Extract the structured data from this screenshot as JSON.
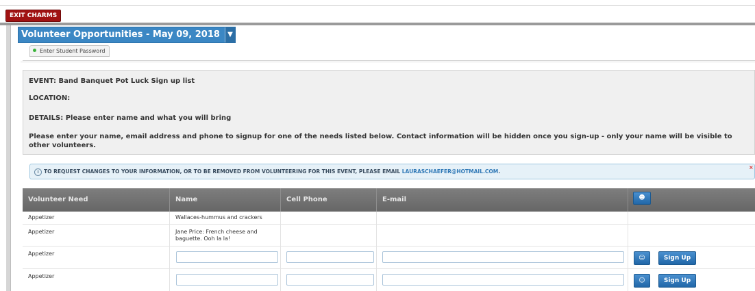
{
  "header": {
    "exit_label": "EXIT CHARMS"
  },
  "title": {
    "text": "Volunteer Opportunities - May 09, 2018",
    "dropdown_glyph": "▼"
  },
  "tabs": {
    "password_tab": "Enter Student Password"
  },
  "event": {
    "name": "EVENT: Band Banquet Pot Luck Sign up list",
    "location": "LOCATION:",
    "details": "DETAILS: Please enter name and what you will bring",
    "instructions": "Please enter your name, email address and phone to signup for one of the needs listed below. Contact information will be hidden once you sign-up - only your name will be visible to other volunteers."
  },
  "alert": {
    "icon": "info-icon",
    "text": "TO REQUEST CHANGES TO YOUR INFORMATION, OR TO BE REMOVED FROM VOLUNTEERING FOR THIS EVENT, PLEASE EMAIL ",
    "email": "LAURASCHAEFER@HOTMAIL.COM",
    "end": ".",
    "close_glyph": "×"
  },
  "table": {
    "headers": [
      "Volunteer Need",
      "Name",
      "Cell Phone",
      "E-mail"
    ],
    "action_icon": "person-icon",
    "rows": [
      {
        "need": "Appetizer",
        "name": "Wallaces-hummus and crackers",
        "editable": false
      },
      {
        "need": "Appetizer",
        "name": "Jane Price: French cheese and baguette. Ooh la la!",
        "editable": false
      },
      {
        "need": "Appetizer",
        "name": "",
        "editable": true
      },
      {
        "need": "Appetizer",
        "name": "",
        "editable": true
      }
    ],
    "signup_label": "Sign Up",
    "lookup_icon": "people-icon"
  },
  "colors": {
    "exit_red": "#a01212",
    "title_blue": "#3b87c4",
    "header_gray": "#6e6e6e",
    "button_blue": "#2a74b8"
  }
}
